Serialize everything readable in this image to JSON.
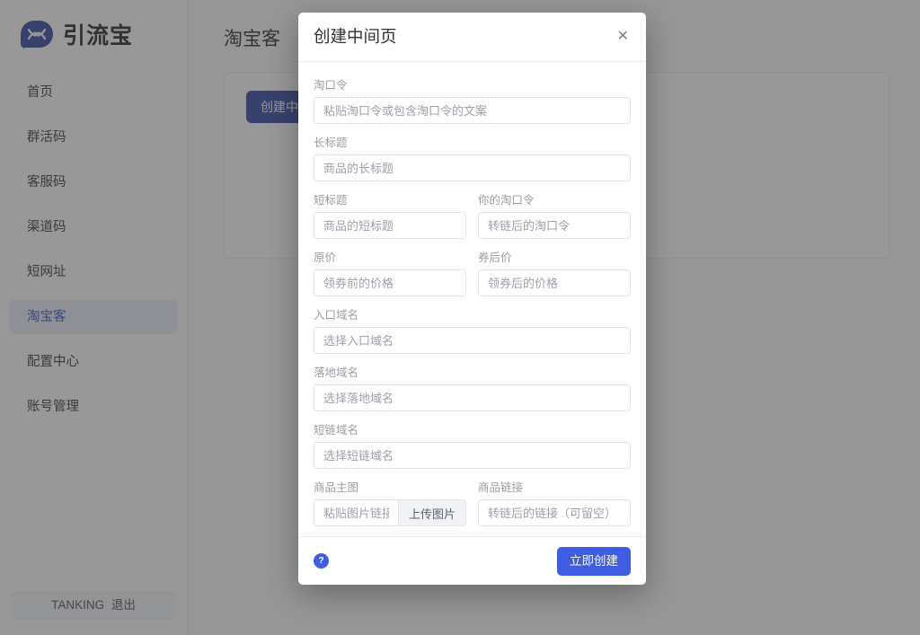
{
  "sidebar": {
    "brand": {
      "name": "引流宝",
      "logo_icon": "chat-bubble-infinity-logo"
    },
    "items": [
      {
        "label": "首页",
        "active": false
      },
      {
        "label": "群活码",
        "active": false
      },
      {
        "label": "客服码",
        "active": false
      },
      {
        "label": "渠道码",
        "active": false
      },
      {
        "label": "短网址",
        "active": false
      },
      {
        "label": "淘宝客",
        "active": true
      },
      {
        "label": "配置中心",
        "active": false
      },
      {
        "label": "账号管理",
        "active": false
      }
    ],
    "footer": {
      "username": "TANKING",
      "logout_label": "退出"
    }
  },
  "main": {
    "page_title": "淘宝客",
    "create_button_label": "创建中间页"
  },
  "modal": {
    "title": "创建中间页",
    "close_icon": "close-icon",
    "fields": {
      "taokouling": {
        "label": "淘口令",
        "placeholder": "粘贴淘口令或包含淘口令的文案",
        "value": ""
      },
      "long_title": {
        "label": "长标题",
        "placeholder": "商品的长标题",
        "value": ""
      },
      "short_title": {
        "label": "短标题",
        "placeholder": "商品的短标题",
        "value": ""
      },
      "your_taokouling": {
        "label": "你的淘口令",
        "placeholder": "转链后的淘口令",
        "value": ""
      },
      "original_price": {
        "label": "原价",
        "placeholder": "领券前的价格",
        "value": ""
      },
      "coupon_price": {
        "label": "券后价",
        "placeholder": "领券后的价格",
        "value": ""
      },
      "entry_domain": {
        "label": "入口域名",
        "placeholder": "选择入口域名",
        "value": ""
      },
      "landing_domain": {
        "label": "落地域名",
        "placeholder": "选择落地域名",
        "value": ""
      },
      "short_link_domain": {
        "label": "短链域名",
        "placeholder": "选择短链域名",
        "value": ""
      },
      "main_image": {
        "label": "商品主图",
        "placeholder": "粘贴图片链接或...",
        "value": "",
        "upload_button_label": "上传图片"
      },
      "product_link": {
        "label": "商品链接",
        "placeholder": "转链后的链接（可留空）",
        "value": ""
      }
    },
    "footer": {
      "help_icon": "question-mark-icon",
      "help_label": "?",
      "submit_label": "立即创建"
    }
  },
  "colors": {
    "brand_blue": "#2b3f9e",
    "accent_blue": "#3f5de0",
    "sidebar_active_bg": "#eceefb",
    "sidebar_active_text": "#2f46c4",
    "overlay": "rgba(68,68,68,0.55)"
  }
}
